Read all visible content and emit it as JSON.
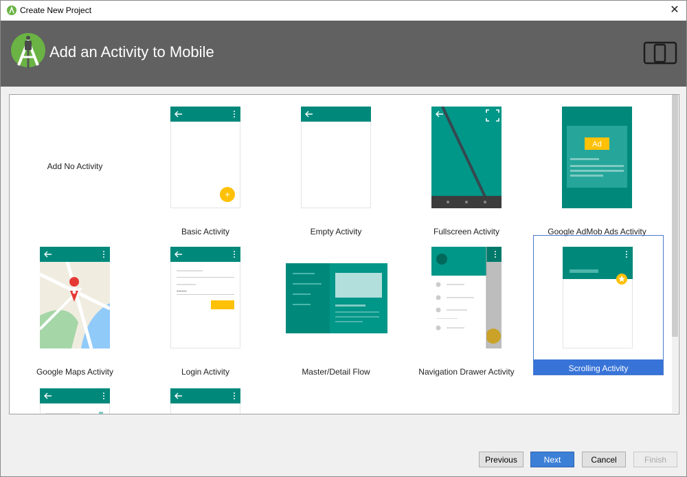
{
  "window": {
    "title": "Create New Project",
    "close_glyph": "✕"
  },
  "header": {
    "title": "Add an Activity to Mobile",
    "logo_icon": "android-studio-icon",
    "form_factor_icon": "phone-tablet-icon"
  },
  "gallery": {
    "selected": "Scrolling Activity",
    "tiles": [
      {
        "label": "Add No Activity"
      },
      {
        "label": "Basic Activity"
      },
      {
        "label": "Empty Activity"
      },
      {
        "label": "Fullscreen Activity"
      },
      {
        "label": "Google AdMob Ads Activity",
        "ad_badge": "Ad"
      },
      {
        "label": "Google Maps Activity"
      },
      {
        "label": "Login Activity"
      },
      {
        "label": "Master/Detail Flow"
      },
      {
        "label": "Navigation Drawer Activity"
      },
      {
        "label": "Scrolling Activity"
      }
    ]
  },
  "colors": {
    "teal_dark": "#00897b",
    "teal": "#009688",
    "teal_light": "#26a69a",
    "accent": "#ffc107",
    "selection": "#3874d8"
  },
  "buttons": {
    "previous": "Previous",
    "next": "Next",
    "cancel": "Cancel",
    "finish": "Finish"
  }
}
